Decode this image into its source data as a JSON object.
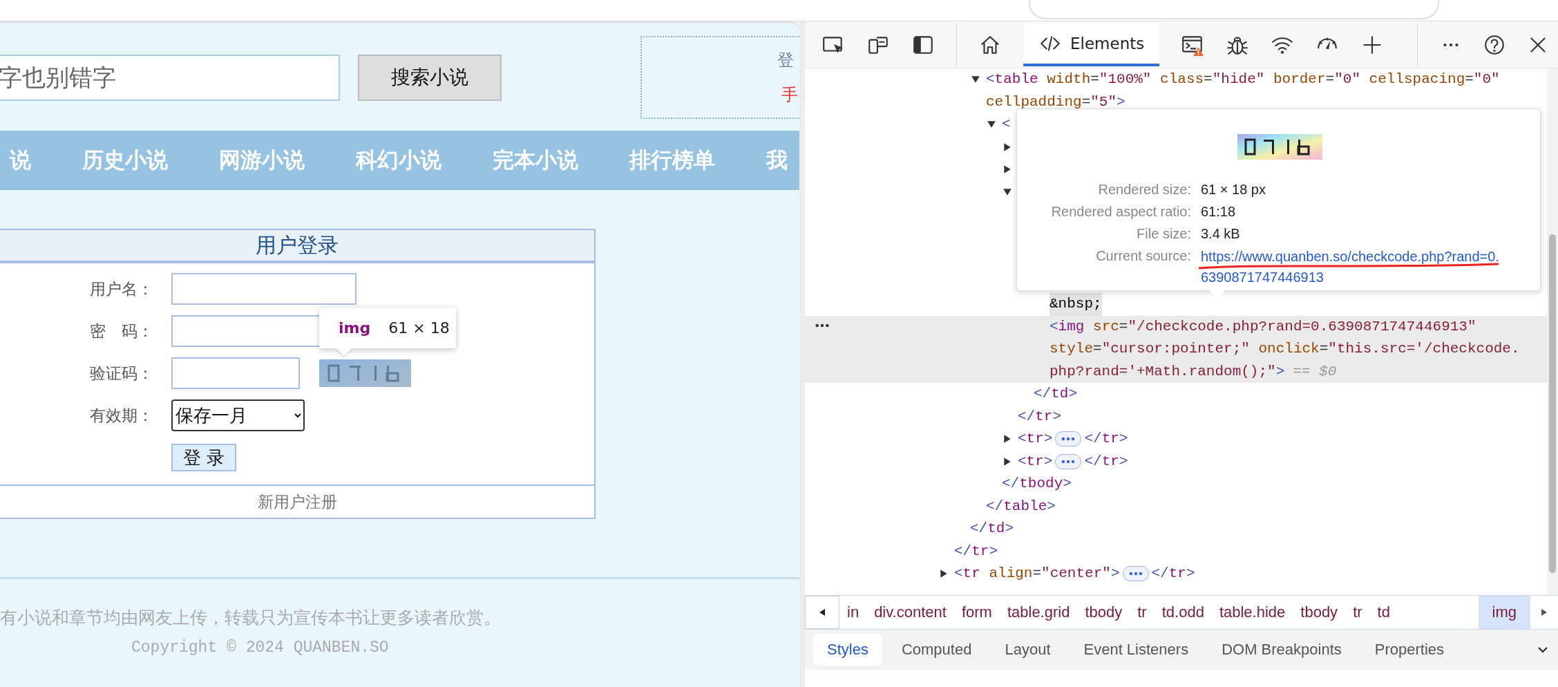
{
  "page": {
    "search": {
      "placeholder": "字也别错字",
      "button": "搜索小说"
    },
    "login_box": {
      "title": "登",
      "link": "手"
    },
    "nav": [
      {
        "label": "说"
      },
      {
        "label": "历史小说"
      },
      {
        "label": "网游小说"
      },
      {
        "label": "科幻小说"
      },
      {
        "label": "完本小说"
      },
      {
        "label": "排行榜单"
      },
      {
        "label": "我"
      }
    ],
    "login_form": {
      "title": "用户登录",
      "fields": [
        {
          "kind": "text",
          "label": "用户名："
        },
        {
          "kind": "password",
          "label": "密　码："
        },
        {
          "kind": "captcha",
          "label": "验证码："
        },
        {
          "kind": "select",
          "label": "有效期：",
          "value": "保存一月"
        }
      ],
      "submit": "登 录",
      "register": "新用户注册"
    },
    "inspect_tooltip": {
      "tag": "img",
      "size": "61 × 18"
    },
    "footer": {
      "notice": "有小说和章节均由网友上传，转载只为宣传本书让更多读者欣赏。",
      "copyright": "Copyright © 2024 QUANBEN.SO"
    }
  },
  "devtools": {
    "toolbar": {
      "tools": [
        {
          "kind": "inspect"
        },
        {
          "kind": "device"
        },
        {
          "kind": "dock"
        }
      ],
      "tabs": [
        {
          "kind": "home",
          "selected": false
        },
        {
          "kind": "elements",
          "label": "Elements",
          "selected": true
        },
        {
          "kind": "console",
          "selected": false
        },
        {
          "kind": "sources",
          "selected": false
        },
        {
          "kind": "network",
          "selected": false
        },
        {
          "kind": "performance",
          "selected": false
        }
      ],
      "extras": [
        {
          "kind": "add"
        }
      ],
      "actions": [
        {
          "kind": "more"
        },
        {
          "kind": "help"
        },
        {
          "kind": "close"
        }
      ]
    },
    "dom_tree": [
      {
        "selected": false,
        "close": "</tr>",
        "children": [
          {
            "selected": false,
            "close": "</td>",
            "children": [
              {
                "open": [
                  "<table width=\"100%\" class=\"hide\" border=\"0\" cellspacing=\"0\"",
                  "cellpadding=\"5\">"
                ],
                "expanded": true,
                "selected": false,
                "close": "</table>",
                "children": [
                  {
                    "open": [
                      "<"
                    ],
                    "expanded": true,
                    "selected": false,
                    "close": "</tbody>",
                    "children": [
                      {
                        "expanded": false,
                        "selected": false
                      },
                      {
                        "expanded": false,
                        "selected": false
                      },
                      {
                        "expanded": true,
                        "selected": false,
                        "close": "</tr>",
                        "children": [
                          {
                            "selected": false,
                            "close": "</td>",
                            "children": [
                              {
                                "text": "&nbsp;"
                              },
                              {
                                "open": [
                                  "<img src=\"/checkcode.php?rand=0.6390871747446913\"",
                                  "style=\"cursor:pointer;\" onclick=\"this.src='/checkcode.",
                                  "php?rand='+Math.random();\">"
                                ],
                                "selected": true,
                                "console_ref": "== $0"
                              }
                            ]
                          }
                        ]
                      },
                      {
                        "open": [
                          "<tr>"
                        ],
                        "expanded": false,
                        "selected": false,
                        "close": "</tr>"
                      },
                      {
                        "open": [
                          "<tr>"
                        ],
                        "expanded": false,
                        "selected": false,
                        "close": "</tr>"
                      }
                    ]
                  }
                ]
              }
            ]
          }
        ]
      },
      {
        "open": [
          "<tr align=\"center\">"
        ],
        "expanded": false,
        "selected": false,
        "close": "</tr>"
      }
    ],
    "image_preview": {
      "rows": [
        {
          "kind": "value",
          "label": "Rendered size:",
          "value": "61 × 18 px"
        },
        {
          "kind": "value",
          "label": "Rendered aspect ratio:",
          "value": "61:18"
        },
        {
          "kind": "value",
          "label": "File size:",
          "value": "3.4 kB"
        },
        {
          "kind": "link",
          "label": "Current source:",
          "value": "https://www.quanben.so/checkcode.php?rand=0.6390871747446913"
        }
      ],
      "source_underlined": true
    },
    "breadcrumbs": [
      {
        "label": "in",
        "selected": false
      },
      {
        "label": "div.content",
        "selected": false
      },
      {
        "label": "form",
        "selected": false
      },
      {
        "label": "table.grid",
        "selected": false
      },
      {
        "label": "tbody",
        "selected": false
      },
      {
        "label": "tr",
        "selected": false
      },
      {
        "label": "td.odd",
        "selected": false
      },
      {
        "label": "table.hide",
        "selected": false
      },
      {
        "label": "tbody",
        "selected": false
      },
      {
        "label": "tr",
        "selected": false
      },
      {
        "label": "td",
        "selected": false
      },
      {
        "label": "img",
        "selected": true
      }
    ],
    "panel_tabs": [
      {
        "label": "Styles",
        "selected": true
      },
      {
        "label": "Computed",
        "selected": false
      },
      {
        "label": "Layout",
        "selected": false
      },
      {
        "label": "Event Listeners",
        "selected": false
      },
      {
        "label": "DOM Breakpoints",
        "selected": false
      },
      {
        "label": "Properties",
        "selected": false
      }
    ]
  }
}
